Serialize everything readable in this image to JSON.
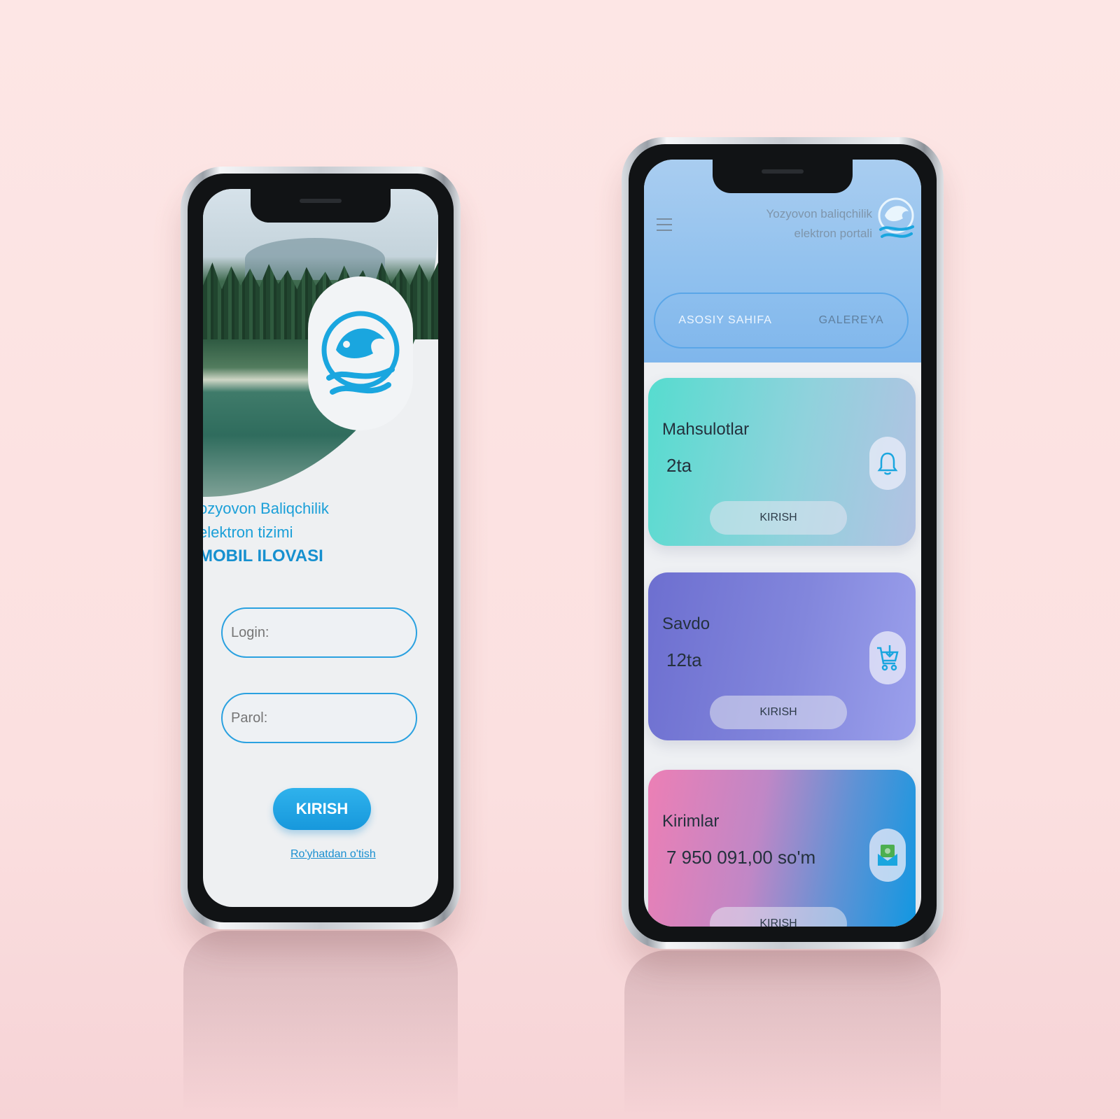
{
  "login_screen": {
    "title_line1": "ozyovon Baliqchilik",
    "title_line2": "elektron tizimi",
    "title_line3": "MOBIL ILOVASI",
    "login_placeholder": "Login:",
    "password_placeholder": "Parol:",
    "submit_label": "KIRISH",
    "register_link": "Ro'yhatdan o'tish"
  },
  "dashboard": {
    "header_line1": "Yozyovon baliqchilik",
    "header_line2": "elektron portali",
    "tabs": [
      {
        "label": "ASOSIY SAHIFA",
        "active": true
      },
      {
        "label": "GALEREYA",
        "active": false
      }
    ],
    "cards": [
      {
        "title": "Mahsulotlar",
        "value": "2ta",
        "button": "KIRISH",
        "icon": "bell-icon"
      },
      {
        "title": "Savdo",
        "value": "12ta",
        "button": "KIRISH",
        "icon": "cart-download-icon"
      },
      {
        "title": "Kirimlar",
        "value": "7 950 091,00 so'm",
        "button": "KIRISH",
        "icon": "money-envelope-icon"
      }
    ]
  },
  "colors": {
    "background": "#fde4e4",
    "brand_blue": "#1a9fd8",
    "header_blue": "#8fc0ee"
  }
}
